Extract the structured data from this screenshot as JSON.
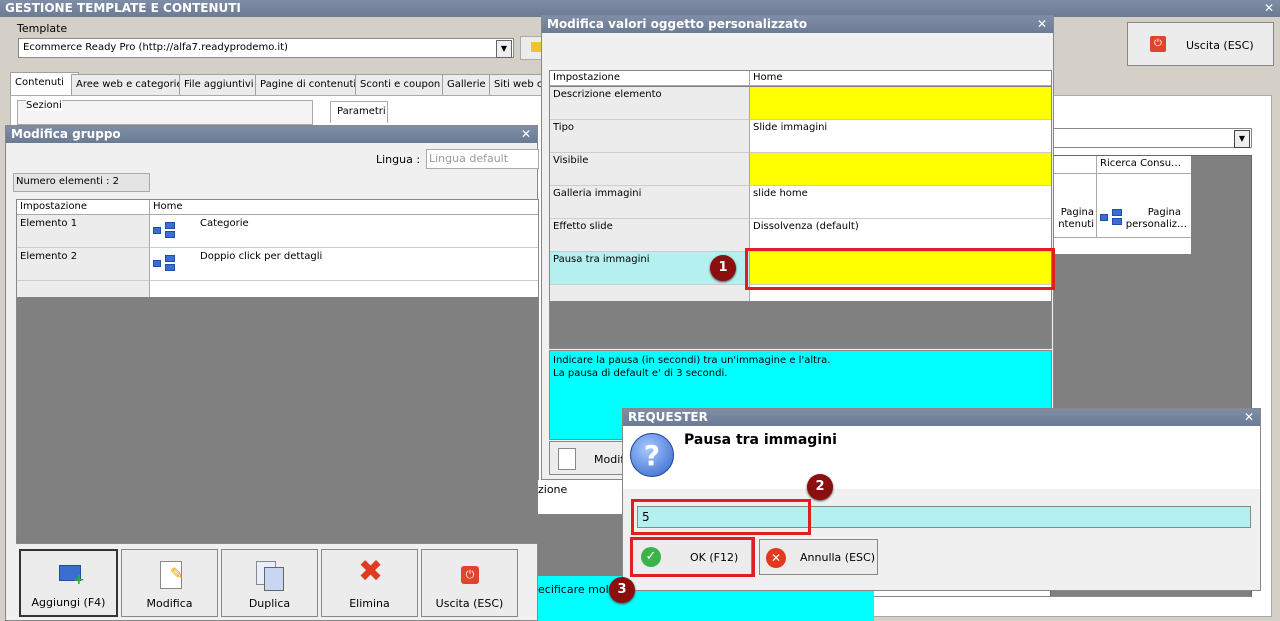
{
  "main_window": {
    "title": "GESTIONE TEMPLATE E CONTENUTI",
    "template_label": "Template",
    "template_value": "Ecommerce Ready Pro (http://alfa7.readyprodemo.it)",
    "exit_button": "Uscita (ESC)",
    "tabs": [
      "Contenuti",
      "Aree web e categorie",
      "File aggiuntivi",
      "Pagine di contenuti",
      "Sconti e coupon",
      "Gallerie",
      "Siti web co"
    ],
    "sezioni_label": "Sezioni",
    "parametri_tab": "Parametri",
    "right_grid_header": "Ricerca Consu…",
    "right_cells": [
      "Pagina",
      "ntenuti",
      "Pagina",
      "personaliz…"
    ],
    "partial_text_1": "zione",
    "partial_text_2": "ecificare moltep"
  },
  "group_window": {
    "title": "Modifica gruppo",
    "lingua_label": "Lingua :",
    "lingua_placeholder": "Lingua default",
    "count_label": "Numero elementi : 2",
    "columns": [
      "Impostazione",
      "Home"
    ],
    "rows": [
      {
        "name": "Elemento 1",
        "value": "Categorie"
      },
      {
        "name": "Elemento 2",
        "value": "Doppio click per dettagli"
      }
    ],
    "buttons": [
      "Aggiungi (F4)",
      "Modifica",
      "Duplica",
      "Elimina",
      "Uscita (ESC)"
    ]
  },
  "object_window": {
    "title": "Modifica valori oggetto personalizzato",
    "columns": [
      "Impostazione",
      "Home"
    ],
    "rows": [
      {
        "name": "Descrizione elemento",
        "value": "",
        "highlight": "#ffff00"
      },
      {
        "name": "Tipo",
        "value": "Slide immagini",
        "highlight": "#ffffff"
      },
      {
        "name": "Visibile",
        "value": "",
        "highlight": "#ffff00"
      },
      {
        "name": "Galleria immagini",
        "value": "slide home",
        "highlight": "#ffffff"
      },
      {
        "name": "Effetto slide",
        "value": "Dissolvenza (default)",
        "highlight": "#ffffff"
      },
      {
        "name": "Pausa tra immagini",
        "value": "",
        "highlight": "#ffff00"
      }
    ],
    "help_line1": "Indicare la pausa (in secondi) tra un'immagine e l'altra.",
    "help_line2": "La pausa di default e' di 3 secondi.",
    "modify_button": "Modifi"
  },
  "requester": {
    "title": "REQUESTER",
    "question": "Pausa tra immagini",
    "input_value": "5",
    "ok_button": "OK (F12)",
    "cancel_button": "Annulla (ESC)"
  },
  "badges": [
    "1",
    "2",
    "3"
  ],
  "colors": {
    "title_bar": "#6b7b94",
    "highlight_yellow": "#ffff00",
    "help_cyan": "#00ffff",
    "input_cyan": "#b4f0f0",
    "badge": "#8b0f0f",
    "callout": "#e02020"
  }
}
